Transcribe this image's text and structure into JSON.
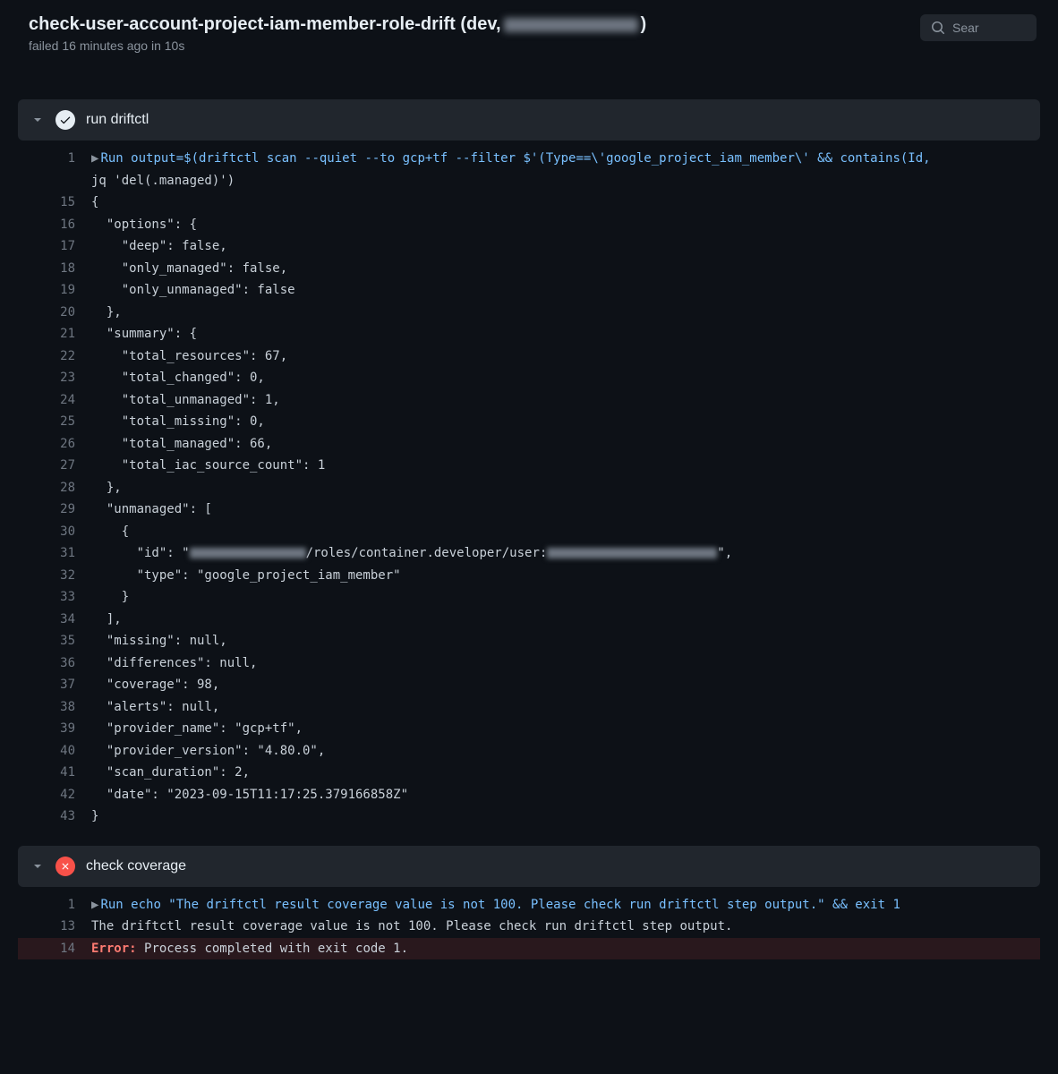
{
  "header": {
    "title_prefix": "check-user-account-project-iam-member-role-drift (dev, ",
    "title_suffix": ")",
    "subtitle": "failed 16 minutes ago in 10s",
    "search_placeholder": "Sear"
  },
  "steps": {
    "run_driftctl": {
      "title": "run driftctl",
      "lines": [
        {
          "n": "1",
          "disclose": true,
          "cmd": true,
          "text": "Run output=$(driftctl scan --quiet --to gcp+tf --filter $'(Type==\\'google_project_iam_member\\' && contains(Id,"
        },
        {
          "n": "",
          "text": "jq 'del(.managed)')"
        },
        {
          "n": "15",
          "text": "{"
        },
        {
          "n": "16",
          "text": "  \"options\": {"
        },
        {
          "n": "17",
          "text": "    \"deep\": false,"
        },
        {
          "n": "18",
          "text": "    \"only_managed\": false,"
        },
        {
          "n": "19",
          "text": "    \"only_unmanaged\": false"
        },
        {
          "n": "20",
          "text": "  },"
        },
        {
          "n": "21",
          "text": "  \"summary\": {"
        },
        {
          "n": "22",
          "text": "    \"total_resources\": 67,"
        },
        {
          "n": "23",
          "text": "    \"total_changed\": 0,"
        },
        {
          "n": "24",
          "text": "    \"total_unmanaged\": 1,"
        },
        {
          "n": "25",
          "text": "    \"total_missing\": 0,"
        },
        {
          "n": "26",
          "text": "    \"total_managed\": 66,"
        },
        {
          "n": "27",
          "text": "    \"total_iac_source_count\": 1"
        },
        {
          "n": "28",
          "text": "  },"
        },
        {
          "n": "29",
          "text": "  \"unmanaged\": ["
        },
        {
          "n": "30",
          "text": "    {"
        },
        {
          "n": "31",
          "text": "      \"id\": \"",
          "redact1": 130,
          "mid": "/roles/container.developer/user:",
          "redact2": 190,
          "tail": "\","
        },
        {
          "n": "32",
          "text": "      \"type\": \"google_project_iam_member\""
        },
        {
          "n": "33",
          "text": "    }"
        },
        {
          "n": "34",
          "text": "  ],"
        },
        {
          "n": "35",
          "text": "  \"missing\": null,"
        },
        {
          "n": "36",
          "text": "  \"differences\": null,"
        },
        {
          "n": "37",
          "text": "  \"coverage\": 98,"
        },
        {
          "n": "38",
          "text": "  \"alerts\": null,"
        },
        {
          "n": "39",
          "text": "  \"provider_name\": \"gcp+tf\","
        },
        {
          "n": "40",
          "text": "  \"provider_version\": \"4.80.0\","
        },
        {
          "n": "41",
          "text": "  \"scan_duration\": 2,"
        },
        {
          "n": "42",
          "text": "  \"date\": \"2023-09-15T11:17:25.379166858Z\""
        },
        {
          "n": "43",
          "text": "}"
        }
      ]
    },
    "check_coverage": {
      "title": "check coverage",
      "lines": [
        {
          "n": "1",
          "disclose": true,
          "cmd": true,
          "text": "Run echo \"The driftctl result coverage value is not 100. Please check run driftctl step output.\" && exit 1"
        },
        {
          "n": "13",
          "text": "The driftctl result coverage value is not 100. Please check run driftctl step output."
        },
        {
          "n": "14",
          "error": true,
          "prefix": "Error: ",
          "text": "Process completed with exit code 1."
        }
      ]
    }
  }
}
